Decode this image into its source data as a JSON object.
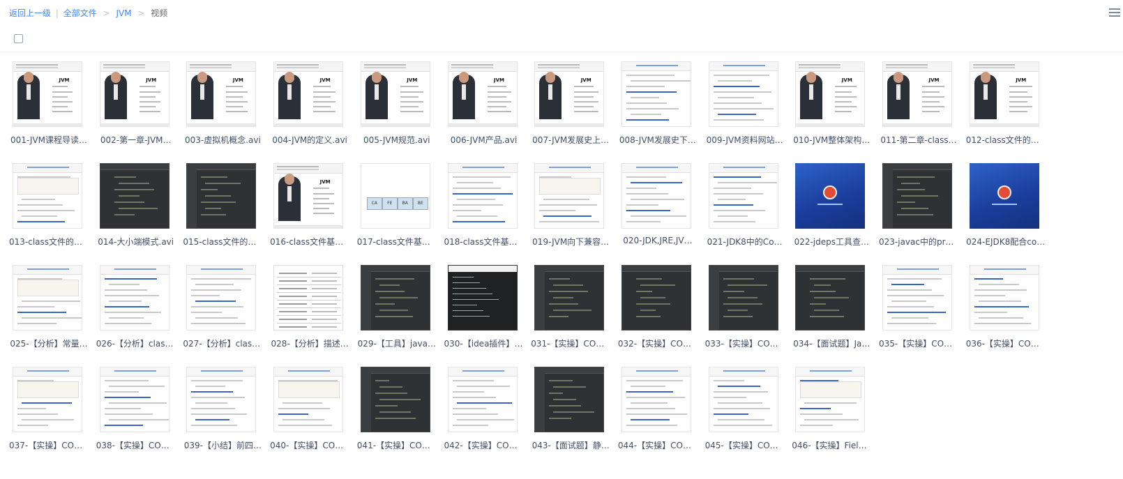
{
  "breadcrumb": {
    "back_label": "返回上一级",
    "separator_pipe": "|",
    "all_files_label": "全部文件",
    "separator": ">",
    "folder_label": "JVM",
    "current_label": "视频"
  },
  "files": [
    {
      "name": "001-JVM课程导读…",
      "thumb": "ppt"
    },
    {
      "name": "002-第一章-JVM…",
      "thumb": "ppt"
    },
    {
      "name": "003-虚拟机概念.avi",
      "thumb": "ppt"
    },
    {
      "name": "004-JVM的定义.avi",
      "thumb": "ppt"
    },
    {
      "name": "005-JVM规范.avi",
      "thumb": "ppt"
    },
    {
      "name": "006-JVM产品.avi",
      "thumb": "ppt"
    },
    {
      "name": "007-JVM发展史上…",
      "thumb": "ppt"
    },
    {
      "name": "008-JVM发展史下…",
      "thumb": "doc"
    },
    {
      "name": "009-JVM资料网站…",
      "thumb": "doc"
    },
    {
      "name": "010-JVM整体架构…",
      "thumb": "ppt"
    },
    {
      "name": "011-第二章-class…",
      "thumb": "ppt"
    },
    {
      "name": "012-class文件的理…",
      "thumb": "ppt"
    },
    {
      "name": "013-class文件的格…",
      "thumb": "doc"
    },
    {
      "name": "014-大小端模式.avi",
      "thumb": "dark"
    },
    {
      "name": "015-class文件的数…",
      "thumb": "dark"
    },
    {
      "name": "016-class文件基本…",
      "thumb": "ppt"
    },
    {
      "name": "017-class文件基本…",
      "thumb": "bytes"
    },
    {
      "name": "018-class文件基本…",
      "thumb": "doc"
    },
    {
      "name": "019-JVM向下兼容…",
      "thumb": "doc"
    },
    {
      "name": "020-JDK,JRE,JV…",
      "thumb": "doc"
    },
    {
      "name": "021-JDK8中的Co…",
      "thumb": "doc"
    },
    {
      "name": "022-jdeps工具查…",
      "thumb": "blue"
    },
    {
      "name": "023-javac中的profi…",
      "thumb": "dark"
    },
    {
      "name": "024-EJDK8配合co…",
      "thumb": "blue"
    },
    {
      "name": "025-【分析】常量…",
      "thumb": "doc"
    },
    {
      "name": "026-【分析】class…",
      "thumb": "doc"
    },
    {
      "name": "027-【分析】class…",
      "thumb": "doc"
    },
    {
      "name": "028-【分析】描述…",
      "thumb": "table"
    },
    {
      "name": "029-【工具】java…",
      "thumb": "dark"
    },
    {
      "name": "030-【idea插件】j…",
      "thumb": "idea"
    },
    {
      "name": "031-【实操】CON…",
      "thumb": "dark"
    },
    {
      "name": "032-【实操】CON…",
      "thumb": "dark"
    },
    {
      "name": "033-【实操】CON…",
      "thumb": "dark"
    },
    {
      "name": "034-【面试题】Ja…",
      "thumb": "dark"
    },
    {
      "name": "035-【实操】CON…",
      "thumb": "doc"
    },
    {
      "name": "036-【实操】CON…",
      "thumb": "doc"
    },
    {
      "name": "037-【实操】CON…",
      "thumb": "doc"
    },
    {
      "name": "038-【实操】CON…",
      "thumb": "doc"
    },
    {
      "name": "039-【小结】前四…",
      "thumb": "doc"
    },
    {
      "name": "040-【实操】CON…",
      "thumb": "doc"
    },
    {
      "name": "041-【实操】CON…",
      "thumb": "dark"
    },
    {
      "name": "042-【实操】CON…",
      "thumb": "doc"
    },
    {
      "name": "043-【面试题】静…",
      "thumb": "dark"
    },
    {
      "name": "044-【实操】CON…",
      "thumb": "doc"
    },
    {
      "name": "045-【实操】CON…",
      "thumb": "doc"
    },
    {
      "name": "046-【实操】Field…",
      "thumb": "doc"
    }
  ],
  "colors": {
    "link": "#3b8cff",
    "filename": "#424e67"
  },
  "icons": {
    "menu": "list-menu-icon",
    "select_all": "checkbox-icon"
  }
}
